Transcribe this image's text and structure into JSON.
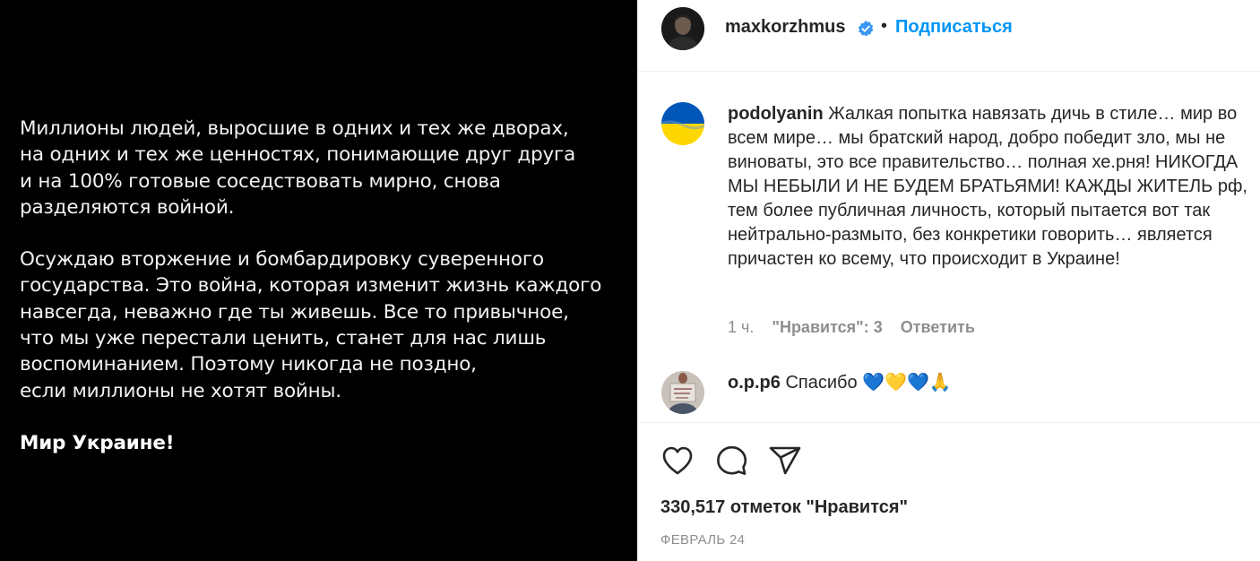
{
  "image": {
    "paragraph1": "Миллионы людей, выросшие в одних и тех же дворах,\nна одних и тех же ценностях, понимающие друг друга\nи на 100% готовые соседствовать мирно, снова\nразделяются войной.",
    "paragraph2": "Осуждаю вторжение и бомбардировку суверенного\nгосударства. Это война, которая изменит жизнь каждого\nнавсегда, неважно где ты живешь. Все то привычное,\nчто мы уже перестали ценить, станет для нас лишь\nвоспоминанием. Поэтому никогда не поздно,\nесли миллионы не хотят войны.",
    "closing": "Мир Украине!"
  },
  "header": {
    "username": "maxkorzhmus",
    "separator": "•",
    "follow_label": "Подписаться"
  },
  "comments": [
    {
      "username": "podolyanin",
      "text": "Жалкая попытка навязать дичь в стиле… мир во всем мире… мы братский народ, добро победит зло, мы не виноваты, это все правительство… полная хе.рня! НИКОГДА МЫ НЕБЫЛИ И НЕ БУДЕМ БРАТЬЯМИ! КАЖДЫ ЖИТЕЛЬ рф, тем более публичная личность, который пытается вот так нейтрально-размыто, без конкретики говорить… является причастен ко всему, что происходит в Украине!",
      "time": "1 ч.",
      "likes": "\"Нравится\": 3",
      "reply_label": "Ответить"
    },
    {
      "username": "o.p.p6",
      "text": "Спасибо 💙💛💙🙏"
    }
  ],
  "footer": {
    "likes_count": "330,517 отметок \"Нравится\"",
    "date": "ФЕВРАЛЬ 24"
  },
  "colors": {
    "accent": "#0095f6",
    "verified": "#3897f0",
    "muted": "#8e8e8e",
    "ukraine_blue": "#0057b7",
    "ukraine_yellow": "#ffd700"
  }
}
